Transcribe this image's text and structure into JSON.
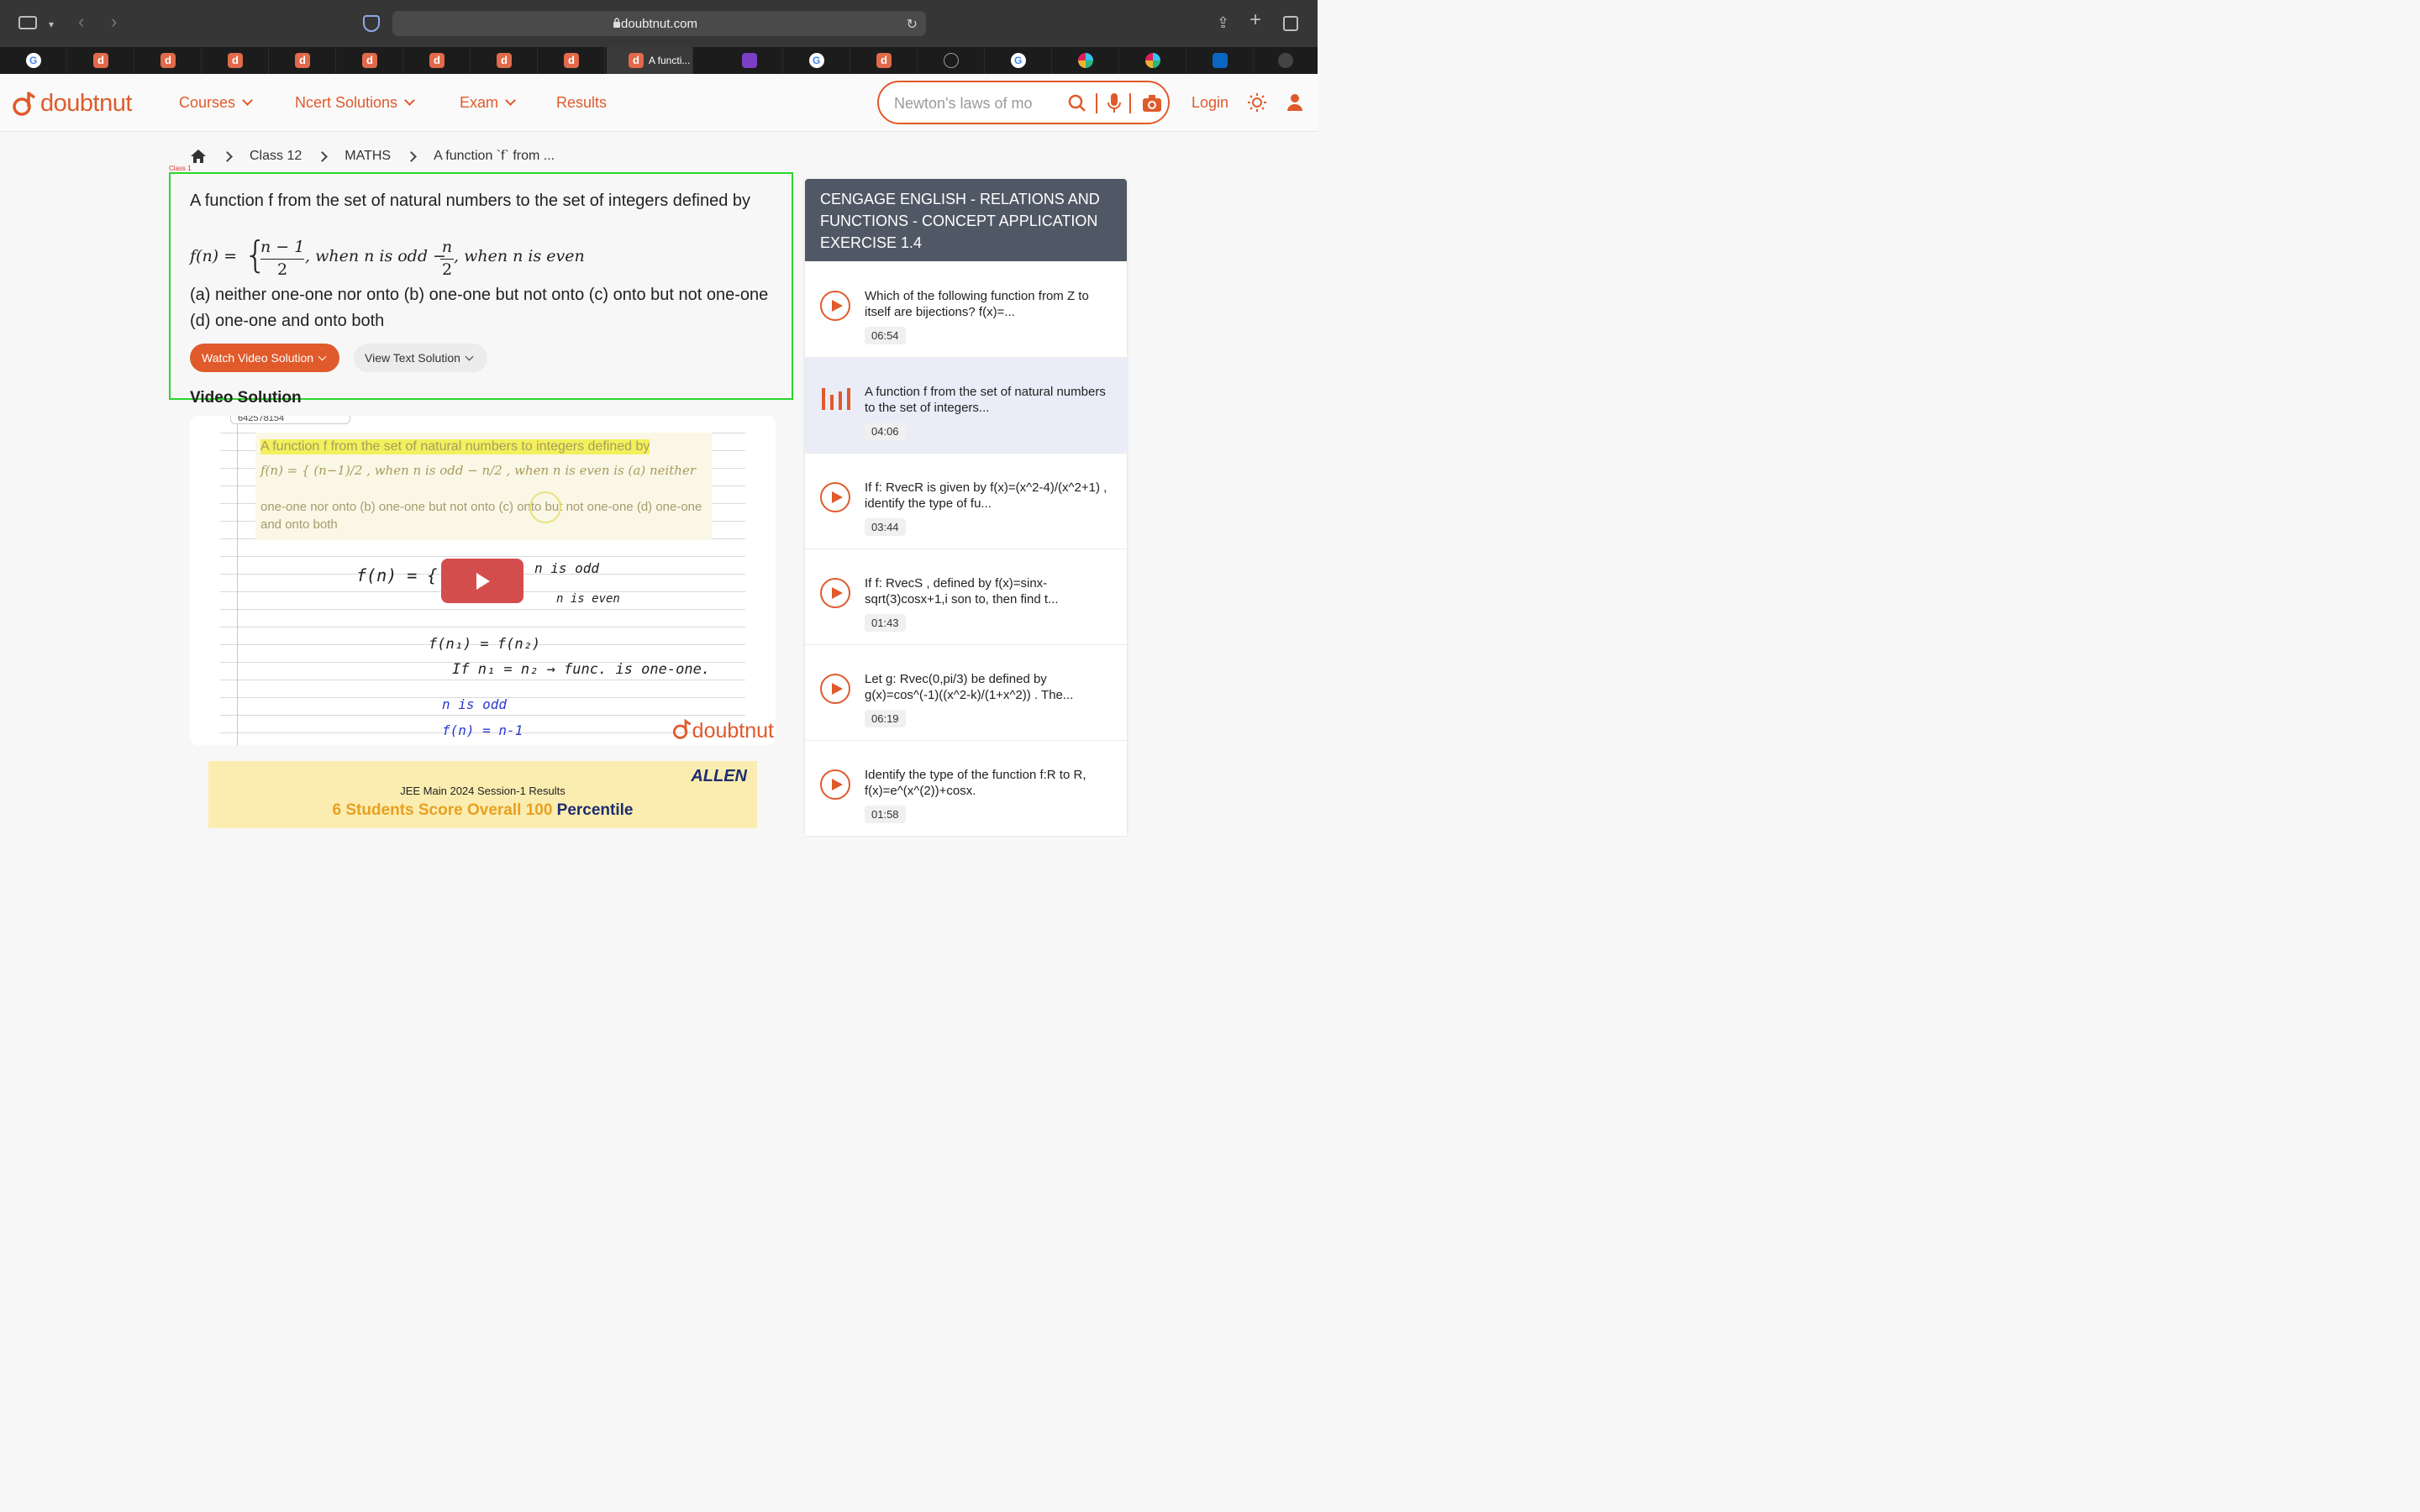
{
  "browser": {
    "url": "doubtnut.com",
    "active_tab_title": "A functi...",
    "tabs": [
      "g",
      "d",
      "d",
      "d",
      "d",
      "d",
      "d",
      "d",
      "d",
      "active",
      "purple",
      "g",
      "d",
      "compass",
      "g",
      "slack",
      "slack",
      "linkedin",
      "globe"
    ]
  },
  "header": {
    "logo_text": "doubtnut",
    "nav": [
      {
        "label": "Courses"
      },
      {
        "label": "Ncert Solutions"
      },
      {
        "label": "Exam"
      },
      {
        "label": "Results"
      }
    ],
    "search_placeholder": "Newton's laws of mo",
    "login": "Login"
  },
  "breadcrumb": {
    "items": [
      "Class 12",
      "MATHS",
      "A function `f` from ..."
    ]
  },
  "tiny_label": "Class 1",
  "question": {
    "text": "A function f from the set of natural numbers to the set of integers defined by",
    "formula_lhs": "f(n) =",
    "formula_num1": "n − 1",
    "formula_den1": "2",
    "formula_mid": ", when n is odd −",
    "formula_num2": "n",
    "formula_den2": "2",
    "formula_end": ", when n is even",
    "options": "(a) neither one-one nor onto (b) one-one but not onto (c) onto but not one-one (d) one-one and onto both",
    "watch_btn": "Watch Video Solution",
    "view_btn": "View Text Solution"
  },
  "video_solution": {
    "title": "Video Solution",
    "id_label": "642578154",
    "panel_line1": "A function f from the set of natural numbers to integers defined by",
    "panel_line2": "f(n) = { (n−1)/2 , when n is odd − n/2 , when n is even is (a) neither",
    "panel_line3": "one-one nor onto (b) one-one but not onto (c) onto but not one-one (d) one-one and onto both",
    "hand_1": "f(n) = {",
    "hand_2": "n is odd",
    "hand_3": "n is even",
    "hand_4": "f(n₁) = f(n₂)",
    "hand_5": "If  n₁ = n₂ → func. is one-one.",
    "hand_6": "n is odd",
    "hand_7": "f(n) = n-1",
    "watermark": "doubtnut"
  },
  "ad": {
    "brand": "ALLEN",
    "line1": "JEE Main 2024 Session-1 Results",
    "line2_a": "6 Students Score Overall ",
    "line2_b": "100",
    "line2_c": " Percentile"
  },
  "sidebar": {
    "heading": "CENGAGE ENGLISH  -  RELATIONS AND FUNCTIONS  -  CONCEPT APPLICATION EXERCISE 1.4",
    "items": [
      {
        "title": "Which of the following function from Z to itself are bijections? f(x)=...",
        "duration": "06:54"
      },
      {
        "title": "A function f from the set of natural numbers to the set of integers...",
        "duration": "04:06"
      },
      {
        "title": "If f: RvecR is given by f(x)=(x^2-4)/(x^2+1) , identify the type of fu...",
        "duration": "03:44"
      },
      {
        "title": "If f: RvecS , defined by f(x)=sinx-sqrt(3)cosx+1,i son to, then find t...",
        "duration": "01:43"
      },
      {
        "title": "Let g: Rvec(0,pi/3) be defined by g(x)=cos^(-1)((x^2-k)/(1+x^2)) . The...",
        "duration": "06:19"
      },
      {
        "title": "Identify the type of the function f:R to R, f(x)=e^(x^(2))+cosx.",
        "duration": "01:58"
      }
    ]
  },
  "colors": {
    "brand": "#e05a2b",
    "highlight_box": "#2bd62b",
    "sidebar_header": "#505866",
    "active_item_bg": "#eaedf8"
  }
}
